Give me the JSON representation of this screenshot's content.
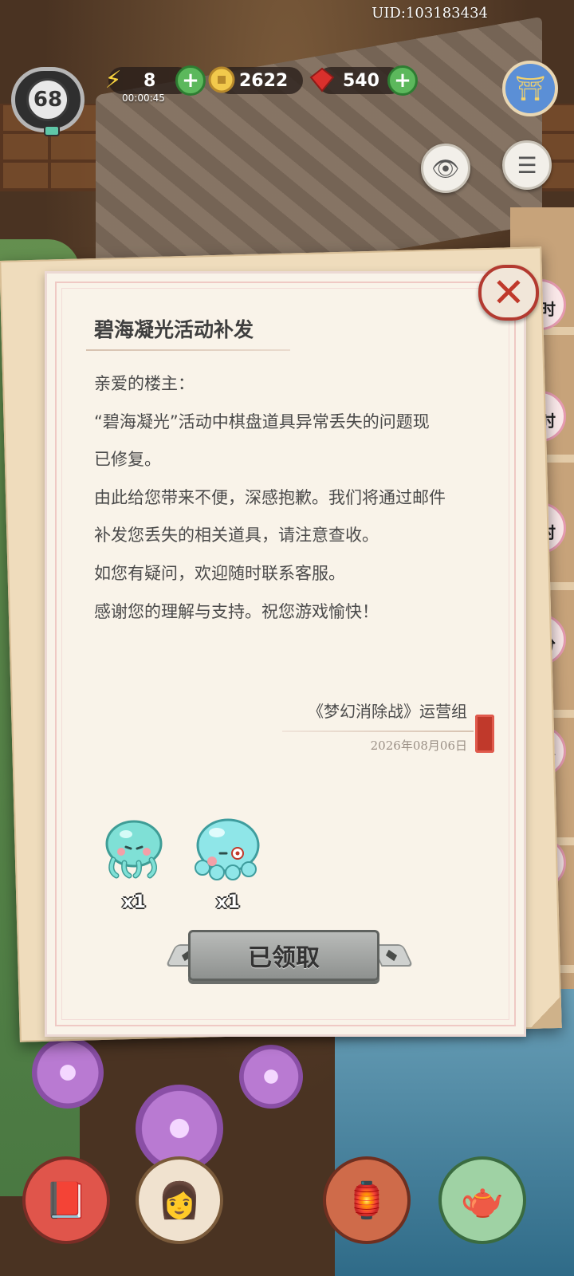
{
  "hud": {
    "uid": "UID:103183434",
    "level": "68",
    "energy": "8",
    "energy_timer": "00:00:45",
    "coins": "2622",
    "gems": "540"
  },
  "side_timers": [
    "时",
    "时",
    "时",
    "6分",
    "5分",
    "时"
  ],
  "mail": {
    "title": "碧海凝光活动补发",
    "lines": [
      "亲爱的楼主：",
      "“碧海凝光”活动中棋盘道具异常丢失的问题现",
      "已修复。",
      "由此给您带来不便，深感抱歉。我们将通过邮件",
      "补发您丢失的相关道具，请注意查收。",
      "如您有疑问，欢迎随时联系客服。",
      "感谢您的理解与支持。祝您游戏愉快！"
    ],
    "signature": "《梦幻消除战》运营组",
    "date": "2026年08月06日",
    "rewards": [
      {
        "icon": "jellyfish-icon",
        "count": "x1",
        "color": "#7fe0d6"
      },
      {
        "icon": "octopus-icon",
        "count": "x1",
        "color": "#8fe6e8"
      }
    ],
    "claim_button": "已领取"
  },
  "colors": {
    "close_red": "#c0392b",
    "paper": "#f9f3e9",
    "button_gray": "#a5a8a6"
  }
}
